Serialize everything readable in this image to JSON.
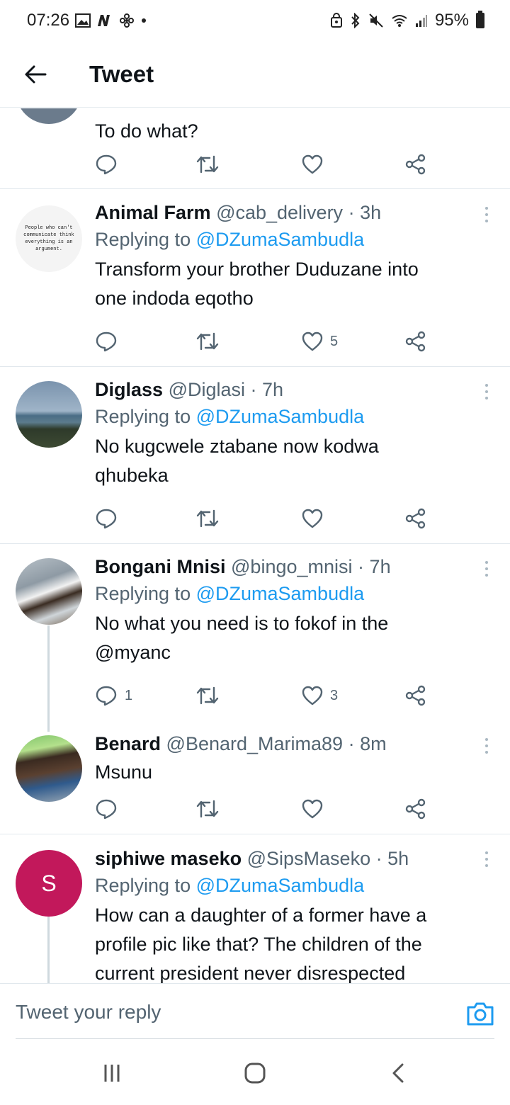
{
  "status_bar": {
    "time": "07:26",
    "battery": "95%"
  },
  "header": {
    "title": "Tweet"
  },
  "tweets": [
    {
      "text": "To do what?",
      "reply_count": "",
      "retweet_count": "",
      "like_count": ""
    },
    {
      "display_name": "Animal Farm",
      "handle": "@cab_delivery",
      "dot": "·",
      "time": "3h",
      "replying_prefix": "Replying to",
      "replying_to": "@DZumaSambudla",
      "avatar_text": [
        "People who can't",
        "communicate think",
        "everything is an",
        "argument."
      ],
      "text_line1": "Transform your brother Duduzane into",
      "text_line2": "one indoda eqotho",
      "reply_count": "",
      "like_count": "5"
    },
    {
      "display_name": "Diglass",
      "handle": "@Diglasi",
      "dot": "·",
      "time": "7h",
      "replying_prefix": "Replying to",
      "replying_to": "@DZumaSambudla",
      "text_line1": "No kugcwele ztabane now kodwa",
      "text_line2": "qhubeka",
      "reply_count": "",
      "like_count": ""
    },
    {
      "display_name": "Bongani Mnisi",
      "handle": "@bingo_mnisi",
      "dot": "·",
      "time": "7h",
      "replying_prefix": "Replying to",
      "replying_to": "@DZumaSambudla",
      "text_line1": "No what you need is to fokof in the",
      "text_mention": "@myanc",
      "reply_count": "1",
      "like_count": "3"
    },
    {
      "display_name": "Benard",
      "handle": "@Benard_Marima89",
      "dot": "·",
      "time": "8m",
      "text_line1": "Msunu",
      "reply_count": "",
      "like_count": ""
    },
    {
      "display_name": "siphiwe maseko",
      "handle": "@SipsMaseko",
      "dot": "·",
      "time": "5h",
      "avatar_letter": "S",
      "replying_prefix": "Replying to",
      "replying_to": "@DZumaSambudla",
      "text_line1": "How can a daughter of a former have a",
      "text_line2": "profile pic like that? The children of the",
      "text_line3": "current president never disrespected"
    }
  ],
  "reply_bar": {
    "placeholder": "Tweet your reply"
  },
  "colors": {
    "accent": "#1d9bf0",
    "secondary_text": "#536471",
    "avatar_s": "#c2185b"
  },
  "icons": {
    "reply": "reply-icon",
    "retweet": "retweet-icon",
    "like": "like-icon",
    "share": "share-icon"
  }
}
